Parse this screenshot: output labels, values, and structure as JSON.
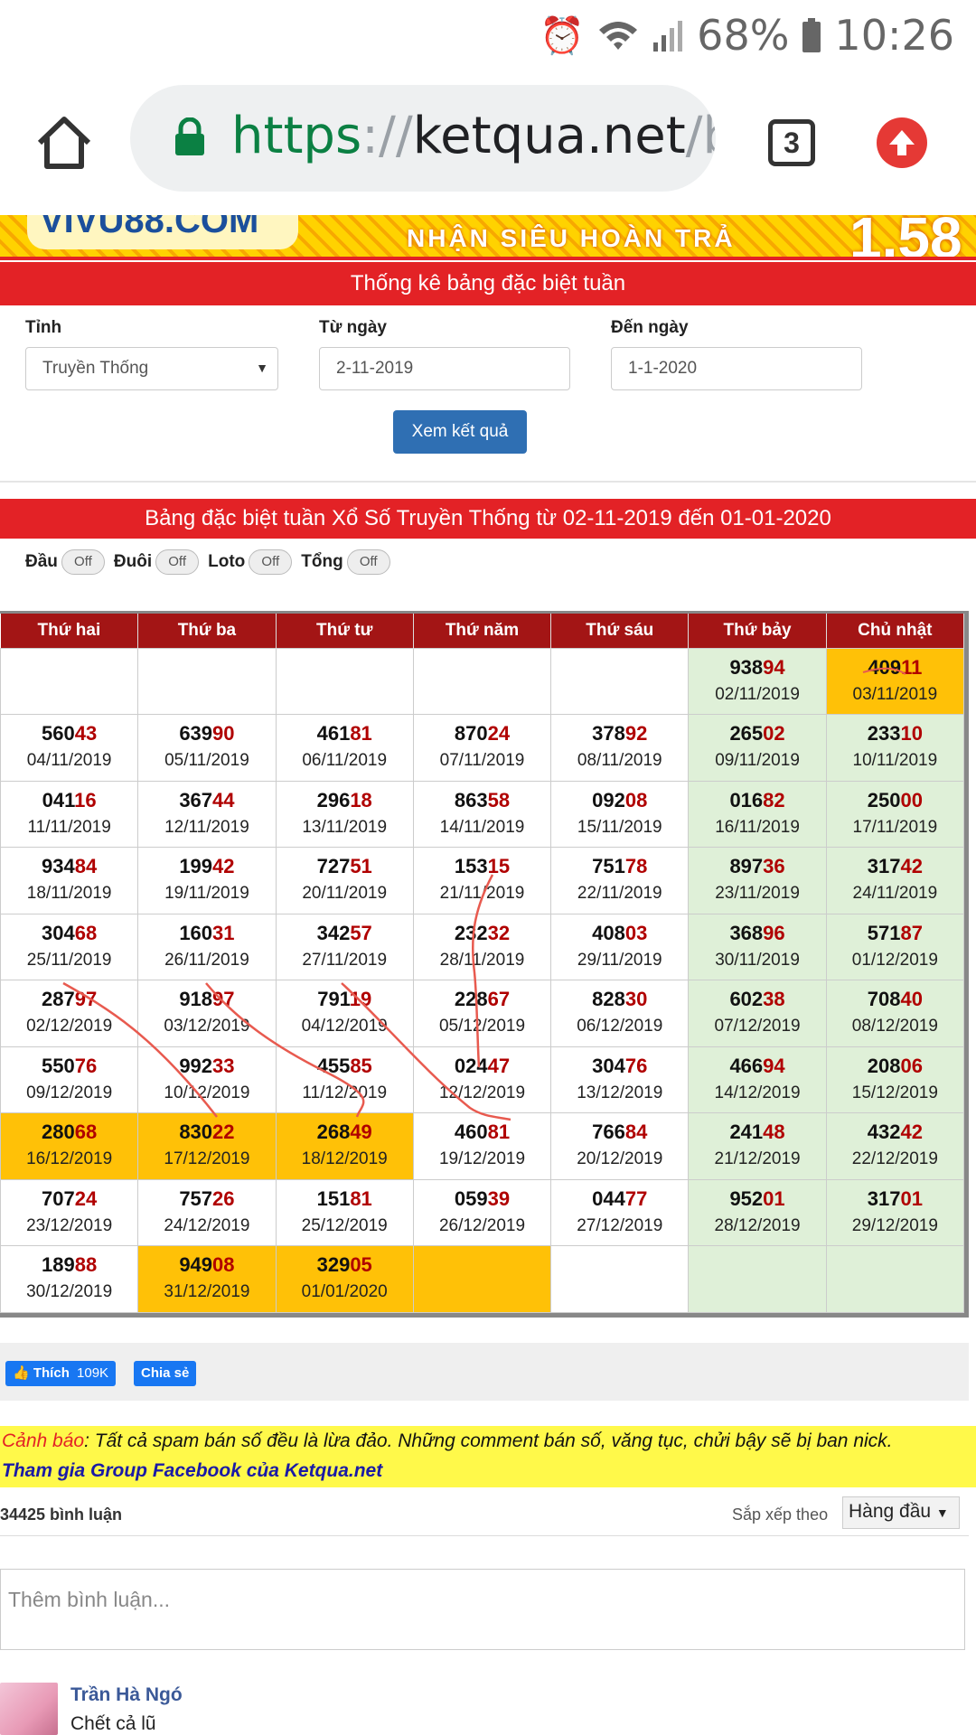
{
  "status": {
    "battery": "68%",
    "time": "10:26"
  },
  "browser": {
    "url_scheme": "https",
    "url_sep": "://",
    "url_host": "ketqua.net",
    "url_path": "/ba",
    "tab_count": "3"
  },
  "banner": {
    "promo": "NHẬN SIÊU HOÀN TRẢ",
    "logo": "VIVU88.COM",
    "big": "1.58"
  },
  "form": {
    "title": "Thống kê bảng đặc biệt tuần",
    "province_label": "Tỉnh",
    "province_value": "Truyền Thống",
    "from_label": "Từ ngày",
    "from_value": "2-11-2019",
    "to_label": "Đến ngày",
    "to_value": "1-1-2020",
    "submit_label": "Xem kết quả"
  },
  "results": {
    "title": "Bảng đặc biệt tuần Xổ Số Truyền Thống từ 02-11-2019 đến 01-01-2020",
    "toggles": [
      {
        "label": "Đầu",
        "state": "Off"
      },
      {
        "label": "Đuôi",
        "state": "Off"
      },
      {
        "label": "Loto",
        "state": "Off"
      },
      {
        "label": "Tổng",
        "state": "Off"
      }
    ],
    "headers": [
      "Thứ hai",
      "Thứ ba",
      "Thứ tư",
      "Thứ năm",
      "Thứ sáu",
      "Thứ bảy",
      "Chủ nhật"
    ],
    "rows": [
      [
        null,
        null,
        null,
        null,
        null,
        {
          "h": "938",
          "t": "94",
          "d": "02/11/2019"
        },
        {
          "h": "409",
          "t": "11",
          "d": "03/11/2019",
          "hl": true
        }
      ],
      [
        {
          "h": "560",
          "t": "43",
          "d": "04/11/2019"
        },
        {
          "h": "639",
          "t": "90",
          "d": "05/11/2019"
        },
        {
          "h": "461",
          "t": "81",
          "d": "06/11/2019"
        },
        {
          "h": "870",
          "t": "24",
          "d": "07/11/2019"
        },
        {
          "h": "378",
          "t": "92",
          "d": "08/11/2019"
        },
        {
          "h": "265",
          "t": "02",
          "d": "09/11/2019"
        },
        {
          "h": "233",
          "t": "10",
          "d": "10/11/2019"
        }
      ],
      [
        {
          "h": "041",
          "t": "16",
          "d": "11/11/2019"
        },
        {
          "h": "367",
          "t": "44",
          "d": "12/11/2019"
        },
        {
          "h": "296",
          "t": "18",
          "d": "13/11/2019"
        },
        {
          "h": "863",
          "t": "58",
          "d": "14/11/2019"
        },
        {
          "h": "092",
          "t": "08",
          "d": "15/11/2019"
        },
        {
          "h": "016",
          "t": "82",
          "d": "16/11/2019"
        },
        {
          "h": "250",
          "t": "00",
          "d": "17/11/2019"
        }
      ],
      [
        {
          "h": "934",
          "t": "84",
          "d": "18/11/2019"
        },
        {
          "h": "199",
          "t": "42",
          "d": "19/11/2019"
        },
        {
          "h": "727",
          "t": "51",
          "d": "20/11/2019"
        },
        {
          "h": "153",
          "t": "15",
          "d": "21/11/2019"
        },
        {
          "h": "751",
          "t": "78",
          "d": "22/11/2019"
        },
        {
          "h": "897",
          "t": "36",
          "d": "23/11/2019"
        },
        {
          "h": "317",
          "t": "42",
          "d": "24/11/2019"
        }
      ],
      [
        {
          "h": "304",
          "t": "68",
          "d": "25/11/2019"
        },
        {
          "h": "160",
          "t": "31",
          "d": "26/11/2019"
        },
        {
          "h": "342",
          "t": "57",
          "d": "27/11/2019"
        },
        {
          "h": "232",
          "t": "32",
          "d": "28/11/2019"
        },
        {
          "h": "408",
          "t": "03",
          "d": "29/11/2019"
        },
        {
          "h": "368",
          "t": "96",
          "d": "30/11/2019"
        },
        {
          "h": "571",
          "t": "87",
          "d": "01/12/2019"
        }
      ],
      [
        {
          "h": "287",
          "t": "97",
          "d": "02/12/2019"
        },
        {
          "h": "918",
          "t": "97",
          "d": "03/12/2019"
        },
        {
          "h": "791",
          "t": "19",
          "d": "04/12/2019"
        },
        {
          "h": "228",
          "t": "67",
          "d": "05/12/2019"
        },
        {
          "h": "828",
          "t": "30",
          "d": "06/12/2019"
        },
        {
          "h": "602",
          "t": "38",
          "d": "07/12/2019"
        },
        {
          "h": "708",
          "t": "40",
          "d": "08/12/2019"
        }
      ],
      [
        {
          "h": "550",
          "t": "76",
          "d": "09/12/2019"
        },
        {
          "h": "992",
          "t": "33",
          "d": "10/12/2019"
        },
        {
          "h": "455",
          "t": "85",
          "d": "11/12/2019"
        },
        {
          "h": "024",
          "t": "47",
          "d": "12/12/2019"
        },
        {
          "h": "304",
          "t": "76",
          "d": "13/12/2019"
        },
        {
          "h": "466",
          "t": "94",
          "d": "14/12/2019"
        },
        {
          "h": "208",
          "t": "06",
          "d": "15/12/2019"
        }
      ],
      [
        {
          "h": "280",
          "t": "68",
          "d": "16/12/2019",
          "hl": true
        },
        {
          "h": "830",
          "t": "22",
          "d": "17/12/2019",
          "hl": true
        },
        {
          "h": "268",
          "t": "49",
          "d": "18/12/2019",
          "hl": true
        },
        {
          "h": "460",
          "t": "81",
          "d": "19/12/2019"
        },
        {
          "h": "766",
          "t": "84",
          "d": "20/12/2019"
        },
        {
          "h": "241",
          "t": "48",
          "d": "21/12/2019"
        },
        {
          "h": "432",
          "t": "42",
          "d": "22/12/2019"
        }
      ],
      [
        {
          "h": "707",
          "t": "24",
          "d": "23/12/2019"
        },
        {
          "h": "757",
          "t": "26",
          "d": "24/12/2019"
        },
        {
          "h": "151",
          "t": "81",
          "d": "25/12/2019"
        },
        {
          "h": "059",
          "t": "39",
          "d": "26/12/2019"
        },
        {
          "h": "044",
          "t": "77",
          "d": "27/12/2019"
        },
        {
          "h": "952",
          "t": "01",
          "d": "28/12/2019"
        },
        {
          "h": "317",
          "t": "01",
          "d": "29/12/2019"
        }
      ],
      [
        {
          "h": "189",
          "t": "88",
          "d": "30/12/2019"
        },
        {
          "h": "949",
          "t": "08",
          "d": "31/12/2019",
          "hl": true
        },
        {
          "h": "329",
          "t": "05",
          "d": "01/01/2020",
          "hl": true
        },
        {
          "empty": true,
          "hl": true
        },
        null,
        null,
        null
      ]
    ]
  },
  "share": {
    "like_label": "Thích",
    "like_count": "109K",
    "share_label": "Chia sẻ"
  },
  "warning": {
    "prefix": "Cảnh báo",
    "text": ": Tất cả spam bán số đều là lừa đảo. Những comment bán số, văng tục, chửi bậy sẽ bị ban nick.",
    "link": "Tham gia Group Facebook của Ketqua.net"
  },
  "comments": {
    "count_label": "34425 bình luận",
    "sort_label": "Sắp xếp theo",
    "sort_value": "Hàng đầu",
    "input_placeholder": "Thêm bình luận...",
    "first": {
      "author": "Trần Hà Ngó",
      "text": "Chết cả lũ"
    }
  },
  "colors": {
    "red": "#e32226",
    "dark_red": "#a31515",
    "highlight": "#ffc107",
    "weekend": "#dff0d8",
    "button_blue": "#2f6fb3",
    "fb_blue": "#1877f2"
  }
}
